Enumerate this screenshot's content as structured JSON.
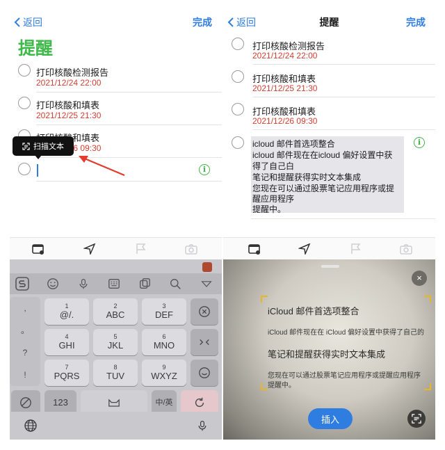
{
  "left": {
    "nav": {
      "back_label": "返回",
      "done_label": "完成"
    },
    "big_title": "提醒",
    "items": [
      {
        "title": "打印核酸检测报告",
        "date": "2021/12/24 22:00"
      },
      {
        "title": "打印核酸和填表",
        "date": "2021/12/25 21:30"
      },
      {
        "title": "打印核酸和填表",
        "date": "2021/12/26 09:30"
      }
    ],
    "tooltip_label": "扫描文本",
    "info_icon_glyph": "i",
    "keyboard": {
      "side_keys": [
        ",",
        "。",
        "?",
        "!"
      ],
      "row1": [
        {
          "num": "1",
          "let": "@/."
        },
        {
          "num": "2",
          "let": "ABC"
        },
        {
          "num": "3",
          "let": "DEF"
        }
      ],
      "row2": [
        {
          "num": "4",
          "let": "GHI"
        },
        {
          "num": "5",
          "let": "JKL"
        },
        {
          "num": "6",
          "let": "MNO"
        }
      ],
      "row3": [
        {
          "num": "7",
          "let": "PQRS"
        },
        {
          "num": "8",
          "let": "TUV"
        },
        {
          "num": "9",
          "let": "WXYZ"
        }
      ],
      "num_switch_label": "123",
      "lang_label": "中/英"
    }
  },
  "right": {
    "nav": {
      "back_label": "返回",
      "title": "提醒",
      "done_label": "完成"
    },
    "items": [
      {
        "title": "打印核酸检测报告",
        "date": "2021/12/24 22:00"
      },
      {
        "title": "打印核酸和填表",
        "date": "2021/12/25 21:30"
      },
      {
        "title": "打印核酸和填表",
        "date": "2021/12/26 09:30"
      }
    ],
    "inserted_text": [
      "icloud 邮件首选项整合",
      "icloud 邮件现在在icloud 偏好设置中获",
      "得了自己白",
      "笔记和提醒获得实时文本集成",
      "您现在可以通过股票笔记应用程序或提",
      "醒应用程序",
      "提醒中。"
    ],
    "camera_text": {
      "heading1": "iCloud 邮件首选项整合",
      "body1": "iCloud 邮件现在在 iCloud 偏好设置中获得了自己的",
      "heading2": "笔记和提醒获得实时文本集成",
      "body2a": "您现在可以通过股票笔记应用程序或提醒应用程序",
      "body2b": "提醒中。"
    },
    "insert_label": "插入",
    "close_glyph": "×"
  },
  "colors": {
    "accent_blue": "#2f7de1",
    "title_green": "#3fb94a",
    "date_red": "#d23f31",
    "info_green": "#46b04c"
  }
}
